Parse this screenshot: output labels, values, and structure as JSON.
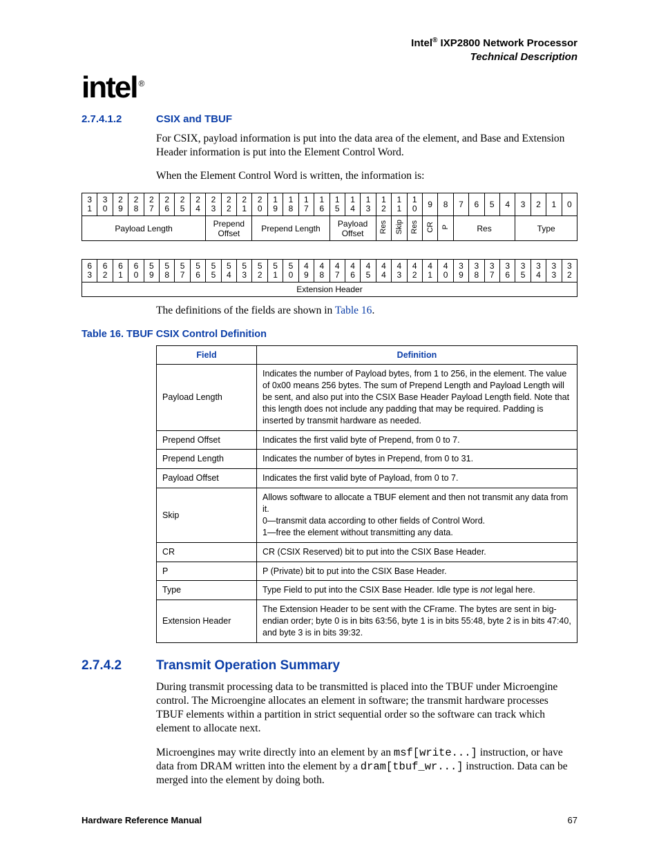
{
  "header": {
    "product_line1_prefix": "Intel",
    "product_line1_reg": "®",
    "product_line1_rest": " IXP2800 Network Processor",
    "product_line2": "Technical Description"
  },
  "logo_text": "intel",
  "logo_reg": "®",
  "sec1": {
    "num": "2.7.4.1.2",
    "title": "CSIX and TBUF"
  },
  "para1": "For CSIX, payload information is put into the data area of the element, and Base and Extension Header information is put into the Element Control Word.",
  "para2": "When the Element Control Word is written, the information is:",
  "bits_hi": [
    "3\n1",
    "3\n0",
    "2\n9",
    "2\n8",
    "2\n7",
    "2\n6",
    "2\n5",
    "2\n4",
    "2\n3",
    "2\n2",
    "2\n1",
    "2\n0",
    "1\n9",
    "1\n8",
    "1\n7",
    "1\n6",
    "1\n5",
    "1\n4",
    "1\n3",
    "1\n2",
    "1\n1",
    "1\n0",
    "9",
    "8",
    "7",
    "6",
    "5",
    "4",
    "3",
    "2",
    "1",
    "0"
  ],
  "fields_hi": {
    "payload_length": "Payload Length",
    "prepend_offset": "Prepend\nOffset",
    "prepend_length": "Prepend Length",
    "payload_offset": "Payload\nOffset",
    "res1": "Res",
    "skip": "Skip",
    "res2": "Res",
    "cr": "CR",
    "p": "P",
    "res3": "Res",
    "type": "Type"
  },
  "bits_lo": [
    "6\n3",
    "6\n2",
    "6\n1",
    "6\n0",
    "5\n9",
    "5\n8",
    "5\n7",
    "5\n6",
    "5\n5",
    "5\n4",
    "5\n3",
    "5\n2",
    "5\n1",
    "5\n0",
    "4\n9",
    "4\n8",
    "4\n7",
    "4\n6",
    "4\n5",
    "4\n4",
    "4\n3",
    "4\n2",
    "4\n1",
    "4\n0",
    "3\n9",
    "3\n8",
    "3\n7",
    "3\n6",
    "3\n5",
    "3\n4",
    "3\n3",
    "3\n2"
  ],
  "fields_lo": {
    "ext_header": "Extension Header"
  },
  "para3_pre": "The definitions of the fields are shown in ",
  "para3_link": "Table 16",
  "para3_post": ".",
  "table16": {
    "caption": "Table 16.  TBUF CSIX Control Definition",
    "h_field": "Field",
    "h_def": "Definition",
    "rows": [
      {
        "f": "Payload Length",
        "d": "Indicates the number of Payload bytes, from 1 to 256, in the element. The value of 0x00 means 256 bytes. The sum of Prepend Length and Payload Length will be sent, and also put into the CSIX Base Header Payload Length field. Note that this length does not include any padding that may be required. Padding is inserted by transmit hardware as needed."
      },
      {
        "f": "Prepend Offset",
        "d": "Indicates the first valid byte of Prepend, from 0 to 7."
      },
      {
        "f": "Prepend Length",
        "d": "Indicates the number of bytes in Prepend, from 0 to 31."
      },
      {
        "f": "Payload Offset",
        "d": "Indicates the first valid byte of Payload, from 0 to 7."
      },
      {
        "f": "Skip",
        "d": "Allows software to allocate a TBUF element and then not transmit any data from it.\n0—transmit data according to other fields of Control Word.\n1—free the element without transmitting any data."
      },
      {
        "f": "CR",
        "d": "CR (CSIX Reserved) bit to put into the CSIX Base Header."
      },
      {
        "f": "P",
        "d": "P (Private) bit to put into the CSIX Base Header."
      },
      {
        "f": "Type",
        "d_html": "Type Field to put into the CSIX Base Header. Idle type is <em class='not'>not</em> legal here."
      },
      {
        "f": "Extension Header",
        "d": "The Extension Header to be sent with the CFrame. The bytes are sent in big-endian order; byte 0 is in bits 63:56, byte 1 is in bits 55:48, byte 2 is in bits 47:40, and byte 3 is in bits 39:32."
      }
    ]
  },
  "sec2": {
    "num": "2.7.4.2",
    "title": "Transmit Operation Summary"
  },
  "para4": "During transmit processing data to be transmitted is placed into the TBUF under Microengine control. The Microengine allocates an element in software; the transmit hardware processes TBUF elements within a partition in strict sequential order so the software can track which element to allocate next.",
  "para5_a": "Microengines may write directly into an element by an ",
  "para5_b": " instruction, or have data from DRAM written into the element by a ",
  "para5_c": " instruction. Data can be merged into the element by doing both.",
  "para5_code1": "msf[write...]",
  "para5_code2": "dram[tbuf_wr...]",
  "footer": {
    "left": "Hardware Reference Manual",
    "right": "67"
  }
}
